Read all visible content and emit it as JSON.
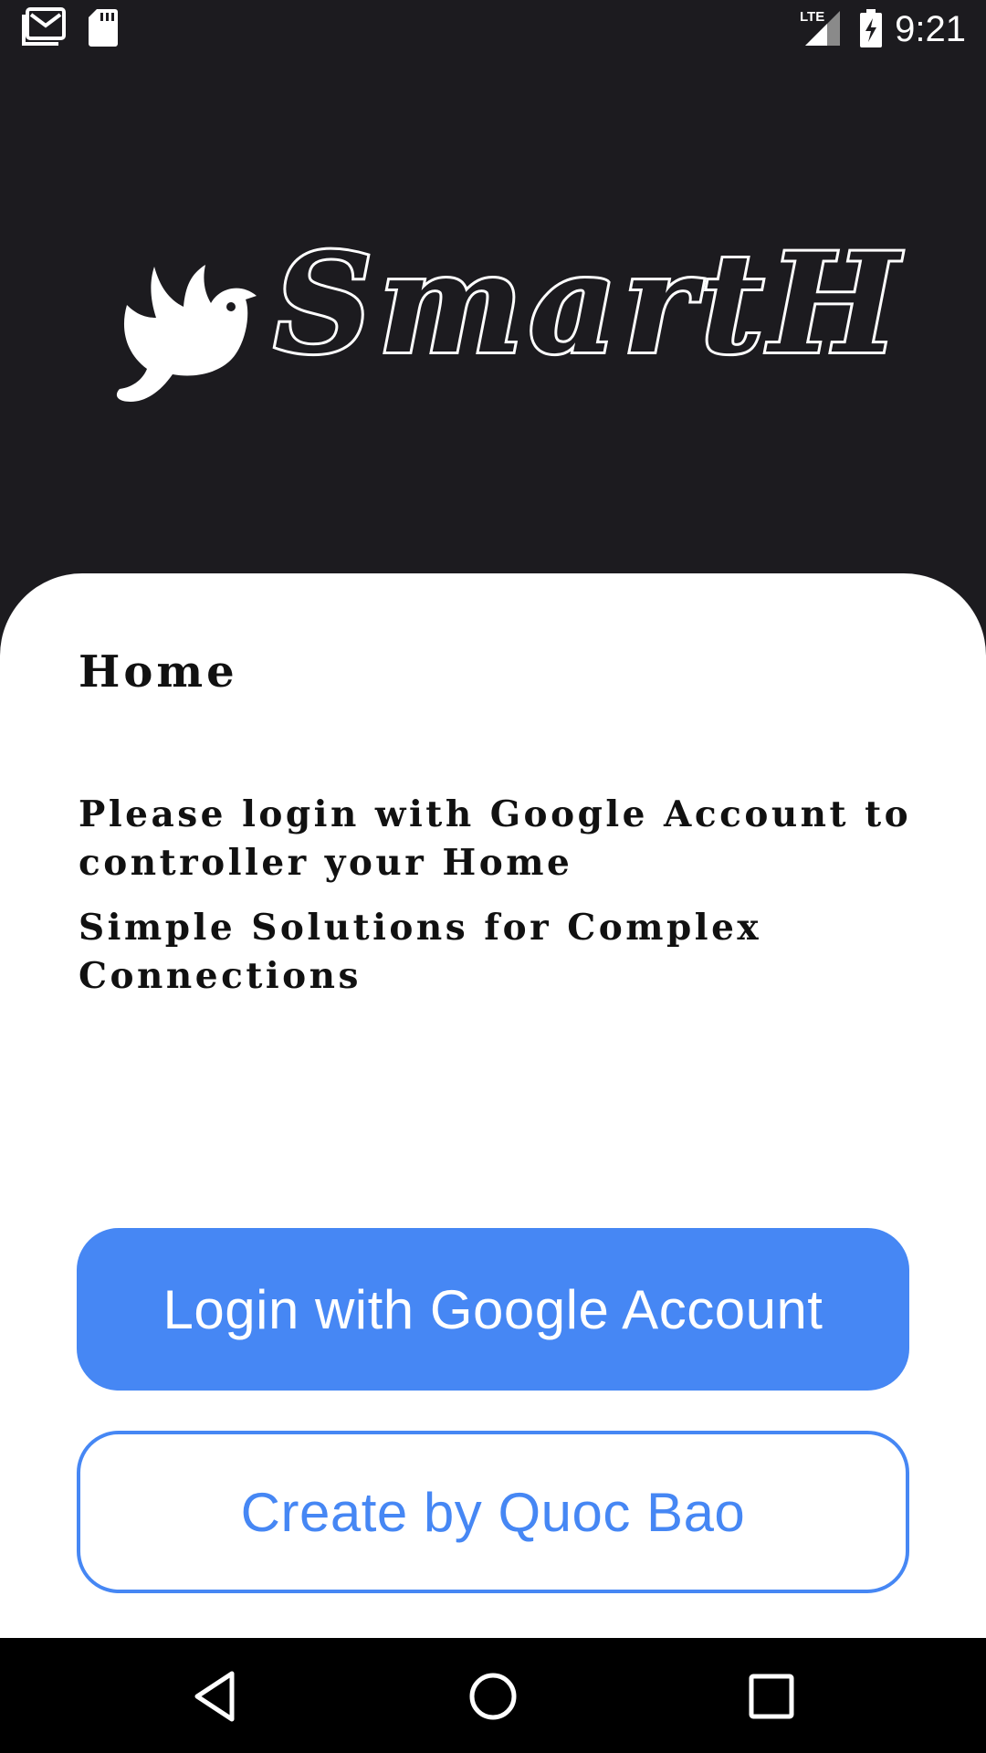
{
  "status_bar": {
    "time": "9:21",
    "network_label": "LTE",
    "icons": [
      "gmail-icon",
      "sd-card-icon",
      "signal-icon",
      "battery-charging-icon"
    ]
  },
  "header": {
    "app_name": "SmartH",
    "logo_icon": "bird-icon"
  },
  "card": {
    "title": "Home",
    "description_1": "Please login with Google Account to controller your Home",
    "description_2": "Simple Solutions for Complex Connections"
  },
  "buttons": {
    "login_label": "Login with Google Account",
    "create_label": "Create by Quoc Bao"
  },
  "nav_bar": {
    "icons": [
      "back-icon",
      "home-icon",
      "recents-icon"
    ]
  },
  "colors": {
    "header_background": "#1c1b1f",
    "card_background": "#ffffff",
    "accent": "#4687f4",
    "nav_background": "#000000"
  }
}
